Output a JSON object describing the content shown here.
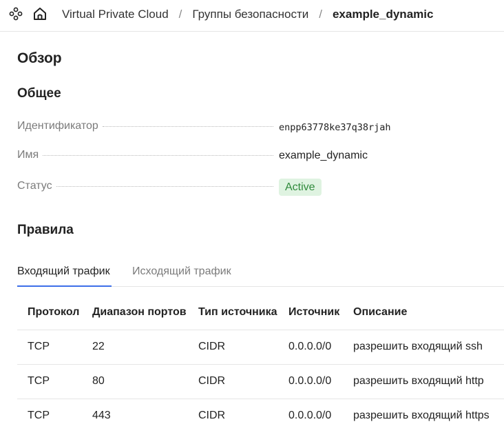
{
  "header": {
    "icons": {
      "hub": "services-hub-icon",
      "home": "home-icon"
    },
    "breadcrumbs": [
      "Virtual Private Cloud",
      "Группы безопасности",
      "example_dynamic"
    ],
    "separator": "/"
  },
  "page": {
    "title": "Обзор",
    "general": {
      "heading": "Общее",
      "rows": [
        {
          "label": "Идентификатор",
          "value": "enpp63778ke37q38rjah"
        },
        {
          "label": "Имя",
          "value": "example_dynamic"
        },
        {
          "label": "Статус",
          "value": "Active"
        }
      ]
    },
    "rules": {
      "heading": "Правила",
      "tabs": [
        {
          "label": "Входящий трафик",
          "active": true
        },
        {
          "label": "Исходящий трафик",
          "active": false
        }
      ],
      "columns": [
        "Протокол",
        "Диапазон портов",
        "Тип источника",
        "Источник",
        "Описание"
      ],
      "rows": [
        [
          "TCP",
          "22",
          "CIDR",
          "0.0.0.0/0",
          "разрешить входящий ssh"
        ],
        [
          "TCP",
          "80",
          "CIDR",
          "0.0.0.0/0",
          "разрешить входящий http"
        ],
        [
          "TCP",
          "443",
          "CIDR",
          "0.0.0.0/0",
          "разрешить входящий https"
        ]
      ]
    }
  },
  "colors": {
    "accent": "#3c6ee8",
    "status_bg": "#dff3e1",
    "status_text": "#2f8a3b"
  }
}
